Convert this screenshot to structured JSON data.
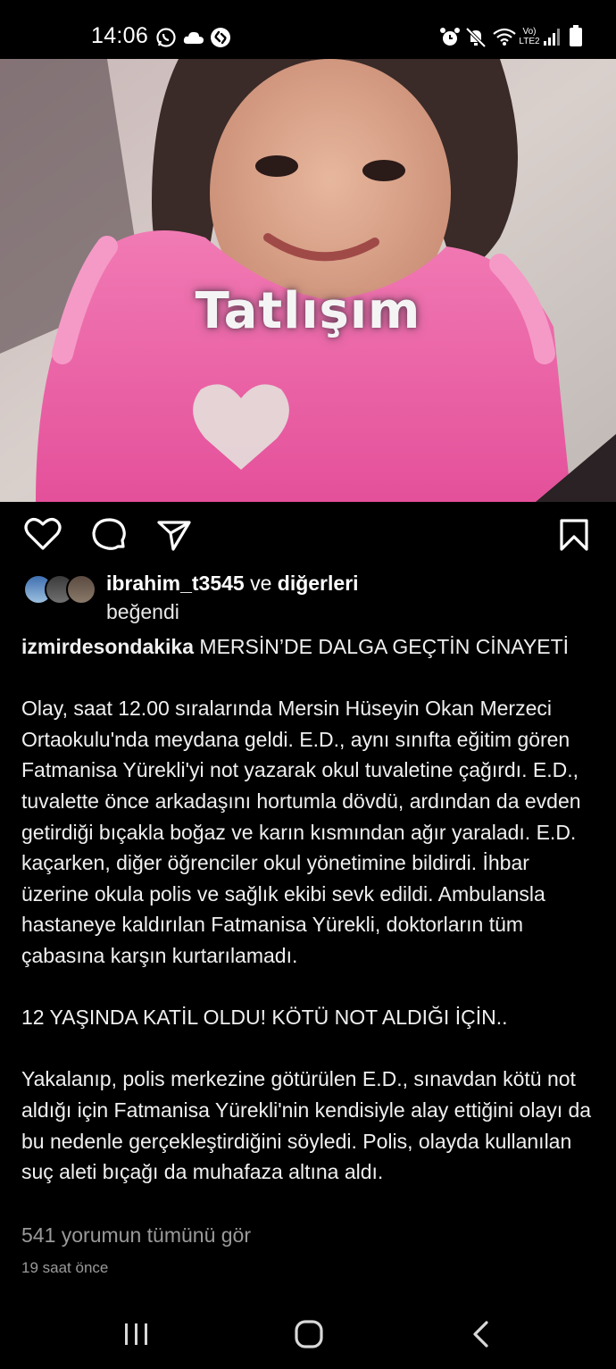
{
  "status_bar": {
    "time": "14:06",
    "network_label_top": "Vo)",
    "network_label_bottom": "LTE2",
    "left_icons": [
      "whatsapp-icon",
      "cloud-icon",
      "shazam-icon"
    ],
    "right_icons": [
      "alarm-icon",
      "mute-icon",
      "wifi-icon",
      "signal-icon",
      "battery-icon"
    ]
  },
  "post": {
    "image_overlay_text": "Tatlışım",
    "liked_by_user": "ibrahim_t3545",
    "liked_by_connector": "ve",
    "liked_by_others": "diğerleri",
    "liked_by_verb": "beğendi",
    "author": "izmirdesondakika",
    "caption_title": "MERSİN’DE DALGA GEÇTİN CİNAYETİ",
    "caption_paragraphs": [
      "Olay, saat 12.00 sıralarında Mersin Hüseyin Okan Merzeci Ortaokulu'nda meydana geldi. E.D., aynı sınıfta eğitim gören Fatmanisa Yürekli'yi not yazarak okul tuvaletine çağırdı. E.D., tuvalette önce arkadaşını hortumla dövdü, ardından da evden getirdiği bıçakla boğaz ve karın kısmından ağır yaraladı. E.D. kaçarken, diğer öğrenciler okul yönetimine bildirdi. İhbar üzerine okula polis ve sağlık ekibi sevk edildi. Ambulansla hastaneye kaldırılan Fatmanisa Yürekli, doktorların tüm çabasına karşın kurtarılamadı.",
      "12 YAŞINDA KATİL OLDU! KÖTÜ NOT ALDIĞI İÇİN..",
      "Yakalanıp, polis merkezine götürülen E.D., sınavdan kötü not aldığı için Fatmanisa Yürekli'nin kendisiyle alay ettiğini olayı da bu nedenle gerçekleştirdiğini söyledi. Polis, olayda kullanılan suç aleti bıçağı da muhafaza altına aldı."
    ],
    "view_comments": "541 yorumun tümünü gör",
    "time_ago": "19 saat önce"
  },
  "nav_bar": {
    "buttons": [
      "recents-icon",
      "home-icon",
      "back-icon"
    ]
  },
  "colors": {
    "background": "#000000",
    "text": "#ffffff",
    "muted": "#9a9a9a",
    "photo_pink": "#e9559a"
  }
}
